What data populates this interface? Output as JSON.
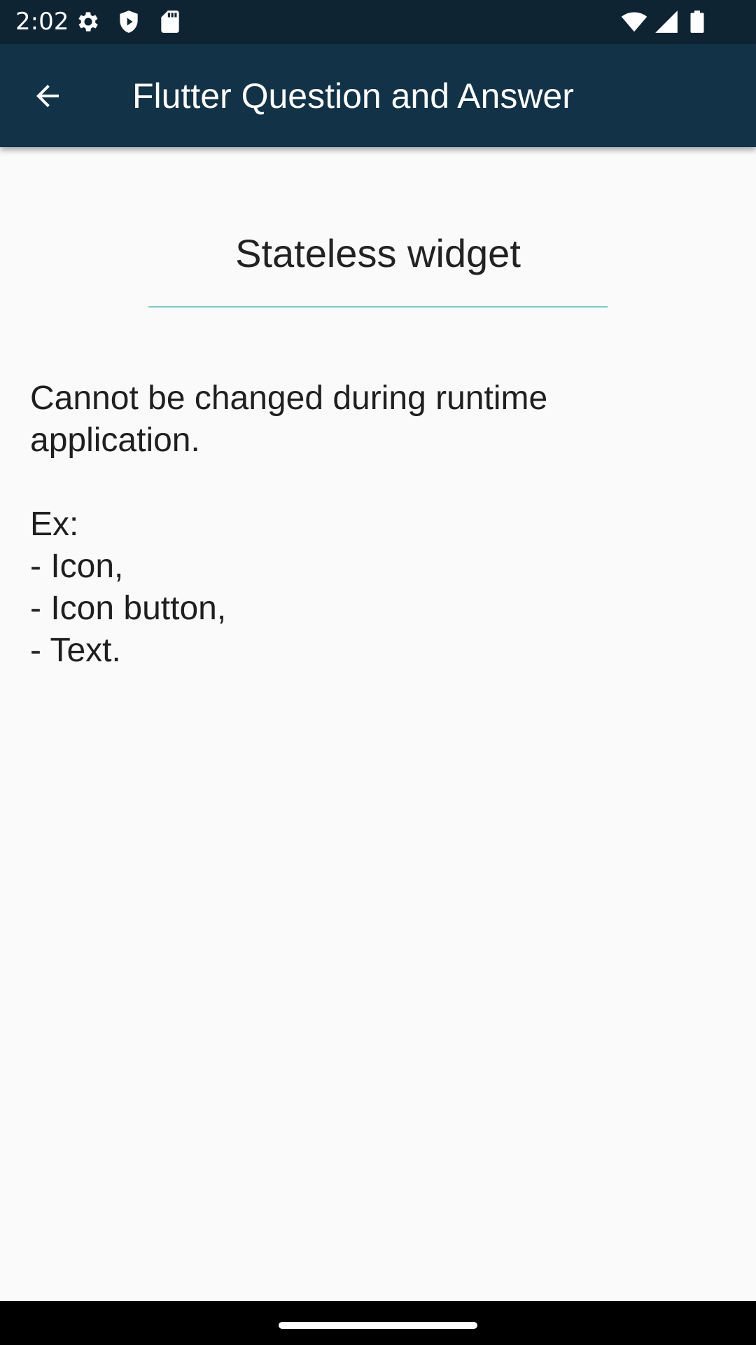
{
  "status_bar": {
    "time": "2:02",
    "icons_left": [
      "settings-gear-icon",
      "shield-icon",
      "sd-card-icon"
    ],
    "icons_right": [
      "wifi-icon",
      "cell-signal-icon",
      "battery-icon"
    ],
    "background": "#0f2433"
  },
  "app_bar": {
    "title": "Flutter Question and Answer",
    "back_icon": "arrow-back-icon",
    "background": "#113247"
  },
  "content": {
    "heading": "Stateless widget",
    "divider_color": "#7fcac9",
    "body_lines": [
      "Cannot be changed during runtime",
      "application.",
      "",
      "Ex:",
      "- Icon,",
      "- Icon button,",
      "- Text."
    ]
  },
  "colors": {
    "page_background": "#fafafa",
    "nav_bar": "#000000"
  }
}
